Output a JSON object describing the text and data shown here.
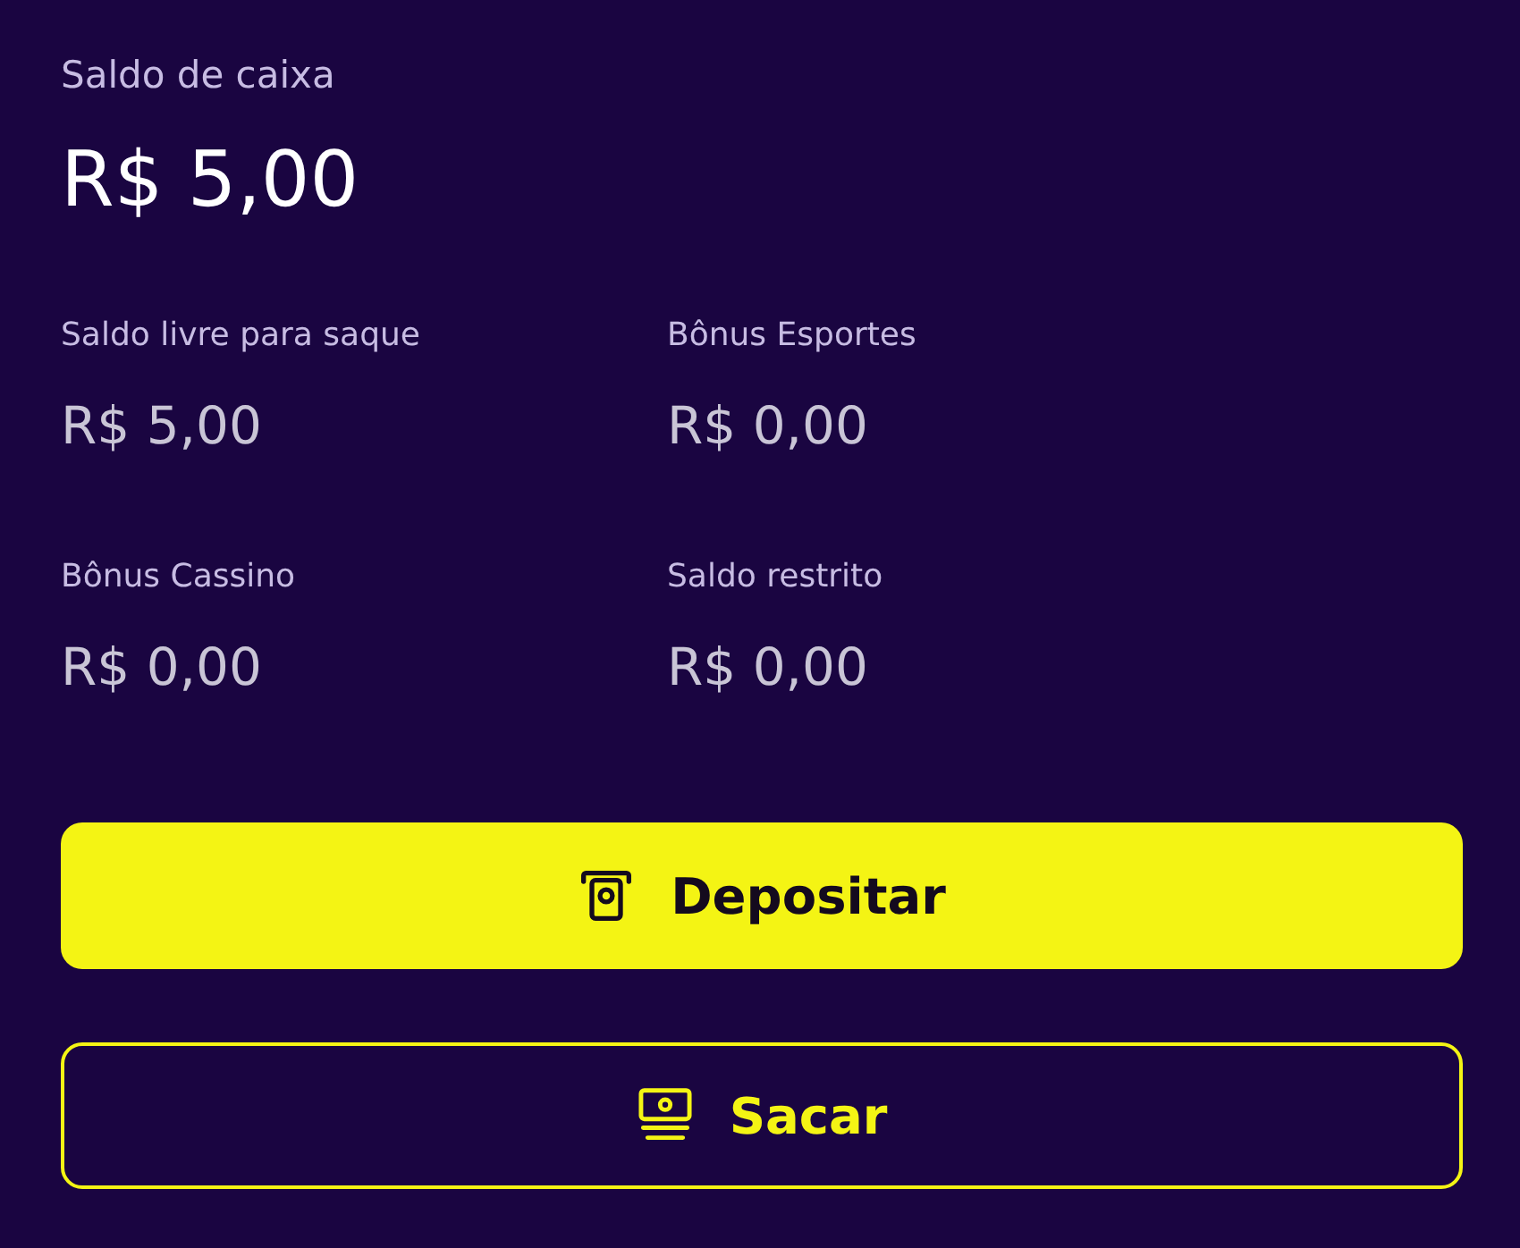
{
  "balance": {
    "label": "Saldo de caixa",
    "value": "R$ 5,00"
  },
  "breakdown": [
    {
      "label": "Saldo livre para saque",
      "value": "R$ 5,00"
    },
    {
      "label": "Bônus Esportes",
      "value": "R$ 0,00"
    },
    {
      "label": "Bônus Cassino",
      "value": "R$ 0,00"
    },
    {
      "label": "Saldo restrito",
      "value": "R$ 0,00"
    }
  ],
  "buttons": [
    {
      "label": "Depositar",
      "kind": "primary"
    },
    {
      "label": "Sacar",
      "kind": "outline"
    }
  ]
}
